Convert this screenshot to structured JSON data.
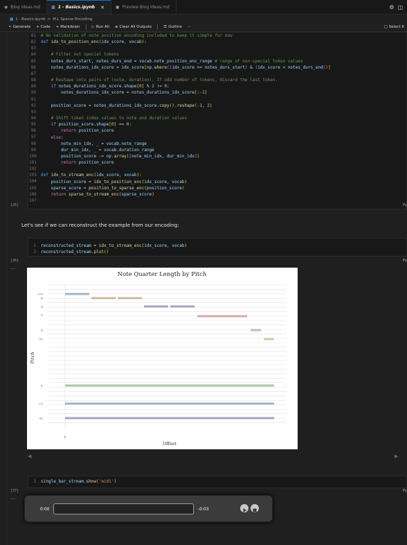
{
  "tabs": [
    {
      "label": "Blog Ideas.md",
      "active": false
    },
    {
      "label": "1 - Basics.ipynb",
      "active": true
    },
    {
      "label": "Preview Blog Ideas.md",
      "active": false
    }
  ],
  "breadcrumb": {
    "file": "1 - Basics.ipynb",
    "separator": ">",
    "section": "M↓ Sparse Encoding"
  },
  "toolbar": {
    "generate": "Generate",
    "code": "+ Code",
    "markdown": "+ Markdown",
    "run_all": "Run All",
    "clear": "Clear All Outputs",
    "outline": "Outline",
    "more": "···",
    "kernel": "Select K"
  },
  "cell1": {
    "exec": "[26]",
    "lang": "Py",
    "lines": [
      "81",
      "82",
      "83",
      "84",
      "85",
      "86",
      "87",
      "88",
      "89",
      "90",
      "91",
      "92",
      "93",
      "94",
      "95",
      "96",
      "97",
      "98",
      "99",
      "100",
      "101",
      "102",
      "103",
      "104",
      "105",
      "106",
      "107"
    ]
  },
  "markdown_text": "Let's see if we can reconstruct the example from our encoding:",
  "cell2": {
    "exec": "[36]",
    "lang": "Py",
    "lines": [
      "1",
      "2"
    ]
  },
  "cell3": {
    "exec": "[37]",
    "lang": "Py",
    "lines": [
      "1"
    ]
  },
  "chart_data": {
    "type": "bar",
    "title": "Note Quarter Length by Pitch",
    "xlabel": "Offset",
    "ylabel": "Pitch",
    "xticks": [
      "0"
    ],
    "yticks": [
      "C♯5",
      "B",
      "A",
      "G",
      "E",
      "D♯",
      "E",
      "C3",
      "A2"
    ]
  },
  "player": {
    "current": "0:00",
    "remaining": "-0:03"
  }
}
